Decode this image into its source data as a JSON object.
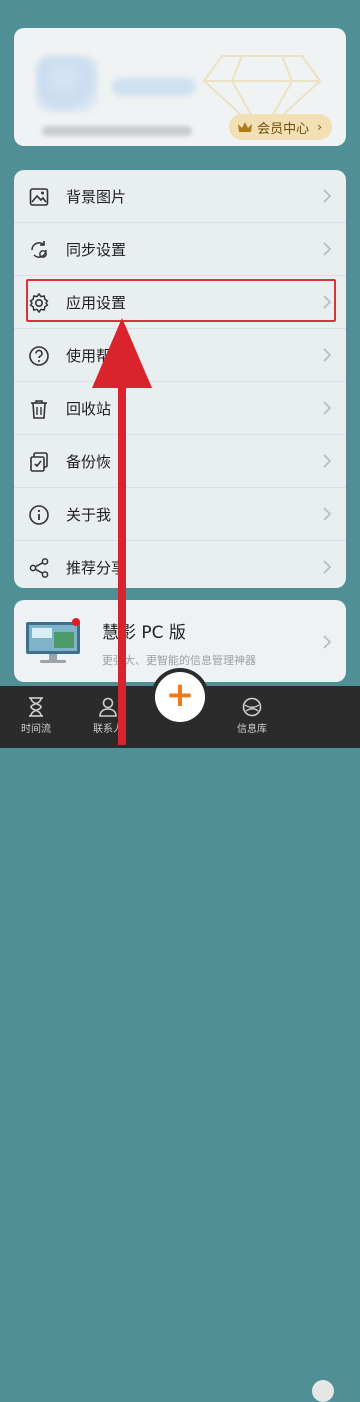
{
  "profile": {
    "vip_label": "会员中心",
    "vip_chevron": "›"
  },
  "menu": {
    "items": [
      {
        "label": "背景图片",
        "icon": "image-icon"
      },
      {
        "label": "同步设置",
        "icon": "sync-icon"
      },
      {
        "label": "应用设置",
        "icon": "gear-icon"
      },
      {
        "label": "使用帮",
        "icon": "help-icon"
      },
      {
        "label": "回收站",
        "icon": "trash-icon"
      },
      {
        "label": "备份恢",
        "icon": "backup-icon"
      },
      {
        "label": "关于我",
        "icon": "info-icon"
      },
      {
        "label": "推荐分享",
        "icon": "share-icon"
      }
    ]
  },
  "promo": {
    "title": "慧影 PC 版",
    "subtitle": "更强大、更智能的信息管理神器"
  },
  "tabbar": {
    "tabs": [
      {
        "label": "时间流",
        "icon": "hourglass-icon"
      },
      {
        "label": "联系人",
        "icon": "contacts-icon"
      },
      {
        "label": "信息库",
        "icon": "library-icon"
      }
    ],
    "fab": "+"
  },
  "colors": {
    "accent": "#f07a1a",
    "highlight": "#d9323b",
    "background": "#4f8f95"
  }
}
